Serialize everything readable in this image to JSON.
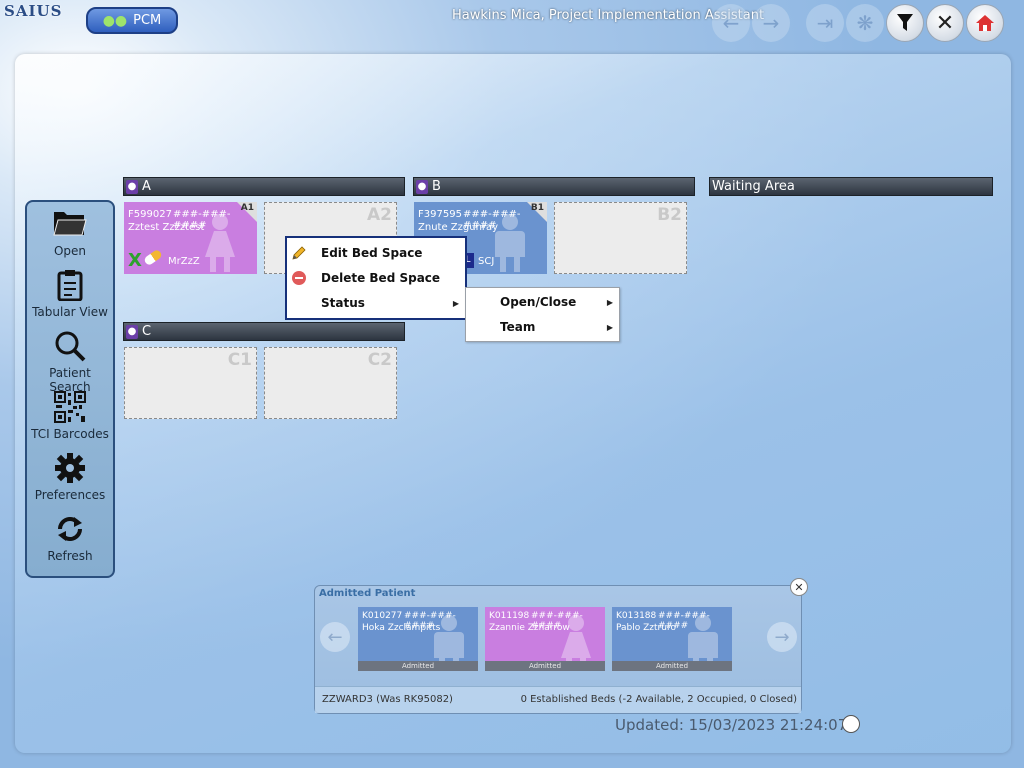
{
  "app": {
    "logo": "SAIUS",
    "module_button": "PCM",
    "user_title": "Hawkins Mica, Project Implementation Assistant"
  },
  "toolbar": {
    "icons": {
      "back": "back-arrow-icon",
      "forward": "forward-arrow-icon",
      "exit": "exit-icon",
      "network": "network-icon",
      "filter": "filter-icon",
      "close": "close-icon",
      "home": "home-icon"
    }
  },
  "sidebar": {
    "items": [
      {
        "label": "Open",
        "icon": "folder-icon"
      },
      {
        "label": "Tabular View",
        "icon": "clipboard-icon"
      },
      {
        "label": "Patient Search",
        "icon": "search-icon"
      },
      {
        "label": "TCI Barcodes",
        "icon": "qr-code-icon"
      },
      {
        "label": "Preferences",
        "icon": "gear-icon"
      },
      {
        "label": "Refresh",
        "icon": "refresh-icon"
      }
    ]
  },
  "bays": {
    "a": {
      "name": "A",
      "beds": {
        "a1": {
          "code": "A1",
          "patient_id": "F599027",
          "masked": "###-###-####",
          "name": "Zztest Zzzztest",
          "consultant": "MrZzZ",
          "color": "#c97ee0"
        },
        "a2": {
          "code": "A2"
        }
      }
    },
    "b": {
      "name": "B",
      "beds": {
        "b1": {
          "code": "B1",
          "patient_id": "F397595",
          "masked": "###-###-####",
          "name": "Znute Zzgunray",
          "team_badge": "L",
          "consultant": "SCJ",
          "color": "#6a93cf"
        },
        "b2": {
          "code": "B2"
        }
      }
    },
    "c": {
      "name": "C",
      "beds": {
        "c1": {
          "code": "C1"
        },
        "c2": {
          "code": "C2"
        }
      }
    },
    "waiting": {
      "name": "Waiting Area"
    }
  },
  "context_menu": {
    "items": [
      {
        "label": "Edit Bed Space",
        "icon": "pencil-icon"
      },
      {
        "label": "Delete Bed Space",
        "icon": "delete-icon"
      },
      {
        "label": "Status"
      }
    ],
    "submenu": [
      {
        "label": "Open/Close"
      },
      {
        "label": "Team"
      }
    ]
  },
  "admitted": {
    "title": "Admitted Patient",
    "patients": [
      {
        "id": "K010277",
        "masked": "###-###-####",
        "name": "Hoka Zzclampitts",
        "status": "Admitted",
        "color": "#6a93cf"
      },
      {
        "id": "K011198",
        "masked": "###-###-####",
        "name": "Zzannie Zzharrow",
        "status": "Admitted",
        "color": "#c97ee0"
      },
      {
        "id": "K013188",
        "masked": "###-###-####",
        "name": "Pablo Zztruro",
        "status": "Admitted",
        "color": "#6a93cf"
      }
    ],
    "ward": "ZZWARD3 (Was RK95082)",
    "beds_summary": "0 Established Beds (-2 Available, 2 Occupied, 0 Closed)"
  },
  "updated": "Updated: 15/03/2023 21:24:07"
}
